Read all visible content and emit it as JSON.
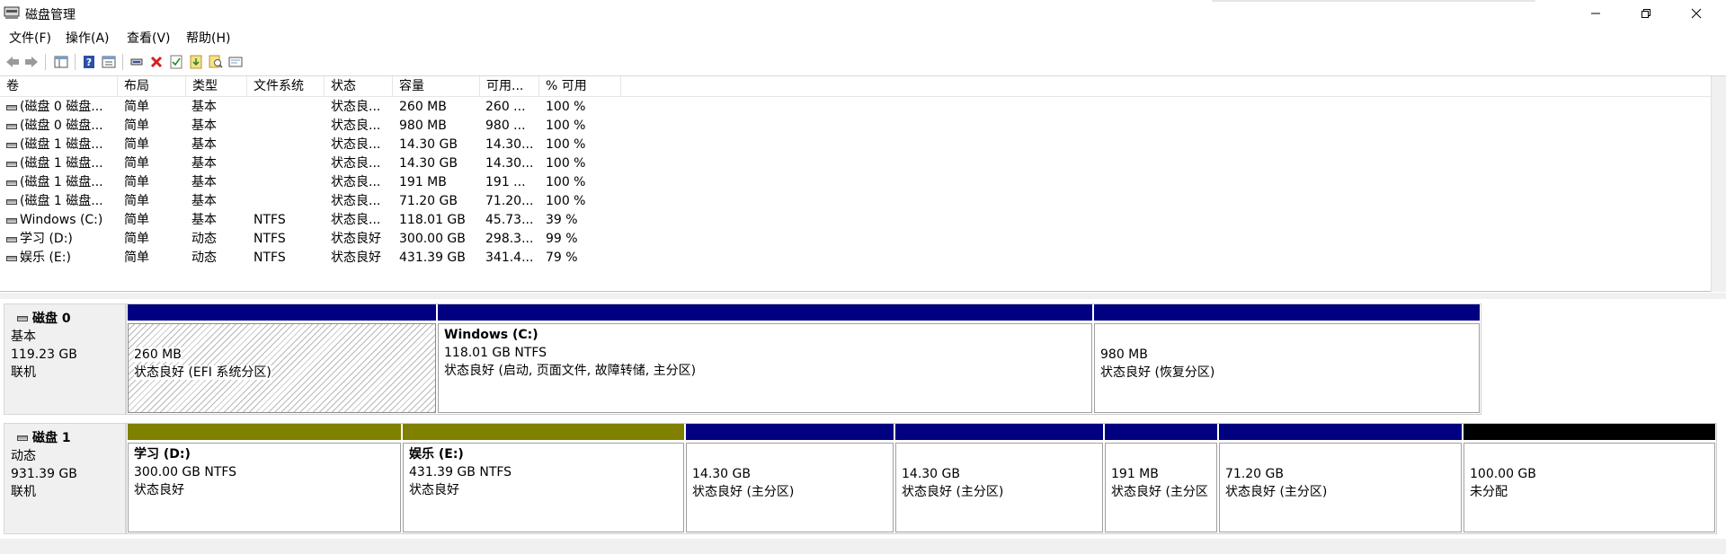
{
  "window": {
    "title": "磁盘管理"
  },
  "menu": [
    "文件(F)",
    "操作(A)",
    "查看(V)",
    "帮助(H)"
  ],
  "toolbar": {
    "icons": [
      "back-icon",
      "forward-icon",
      "console-tree-icon",
      "help-icon",
      "properties-icon",
      "connect-icon",
      "delete-icon",
      "check-icon",
      "import-icon",
      "search-icon",
      "settings-icon"
    ]
  },
  "colors": {
    "primary": "#000080",
    "simple_dynamic": "#808000",
    "unallocated": "#000000"
  },
  "columns": [
    "卷",
    "布局",
    "类型",
    "文件系统",
    "状态",
    "容量",
    "可用...",
    "% 可用"
  ],
  "volumes": [
    {
      "name": "(磁盘 0 磁盘...",
      "layout": "简单",
      "type": "基本",
      "fs": "",
      "status": "状态良...",
      "capacity": "260 MB",
      "free": "260 ...",
      "pct": "100 %"
    },
    {
      "name": "(磁盘 0 磁盘...",
      "layout": "简单",
      "type": "基本",
      "fs": "",
      "status": "状态良...",
      "capacity": "980 MB",
      "free": "980 ...",
      "pct": "100 %"
    },
    {
      "name": "(磁盘 1 磁盘...",
      "layout": "简单",
      "type": "基本",
      "fs": "",
      "status": "状态良...",
      "capacity": "14.30 GB",
      "free": "14.30...",
      "pct": "100 %"
    },
    {
      "name": "(磁盘 1 磁盘...",
      "layout": "简单",
      "type": "基本",
      "fs": "",
      "status": "状态良...",
      "capacity": "14.30 GB",
      "free": "14.30...",
      "pct": "100 %"
    },
    {
      "name": "(磁盘 1 磁盘...",
      "layout": "简单",
      "type": "基本",
      "fs": "",
      "status": "状态良...",
      "capacity": "191 MB",
      "free": "191 ...",
      "pct": "100 %"
    },
    {
      "name": "(磁盘 1 磁盘...",
      "layout": "简单",
      "type": "基本",
      "fs": "",
      "status": "状态良...",
      "capacity": "71.20 GB",
      "free": "71.20...",
      "pct": "100 %"
    },
    {
      "name": "Windows (C:)",
      "layout": "简单",
      "type": "基本",
      "fs": "NTFS",
      "status": "状态良...",
      "capacity": "118.01 GB",
      "free": "45.73...",
      "pct": "39 %"
    },
    {
      "name": "学习 (D:)",
      "layout": "简单",
      "type": "动态",
      "fs": "NTFS",
      "status": "状态良好",
      "capacity": "300.00 GB",
      "free": "298.3...",
      "pct": "99 %"
    },
    {
      "name": "娱乐 (E:)",
      "layout": "简单",
      "type": "动态",
      "fs": "NTFS",
      "status": "状态良好",
      "capacity": "431.39 GB",
      "free": "341.4...",
      "pct": "79 %"
    }
  ],
  "disks": [
    {
      "name": "磁盘 0",
      "type": "基本",
      "size": "119.23 GB",
      "state": "联机",
      "partitions": [
        {
          "label": "",
          "size": "260 MB",
          "status": "状态良好 (EFI 系统分区)",
          "bar": "primary"
        },
        {
          "label": "Windows  (C:)",
          "size": "118.01 GB NTFS",
          "status": "状态良好 (启动, 页面文件, 故障转储, 主分区)",
          "bar": "primary"
        },
        {
          "label": "",
          "size": "980 MB",
          "status": "状态良好 (恢复分区)",
          "bar": "primary"
        }
      ]
    },
    {
      "name": "磁盘 1",
      "type": "动态",
      "size": "931.39 GB",
      "state": "联机",
      "partitions": [
        {
          "label": "学习  (D:)",
          "size": "300.00 GB NTFS",
          "status": "状态良好",
          "bar": "simple_dynamic"
        },
        {
          "label": "娱乐  (E:)",
          "size": "431.39 GB NTFS",
          "status": "状态良好",
          "bar": "simple_dynamic"
        },
        {
          "label": "",
          "size": "14.30 GB",
          "status": "状态良好 (主分区)",
          "bar": "primary"
        },
        {
          "label": "",
          "size": "14.30 GB",
          "status": "状态良好 (主分区)",
          "bar": "primary"
        },
        {
          "label": "",
          "size": "191 MB",
          "status": "状态良好 (主分区",
          "bar": "primary"
        },
        {
          "label": "",
          "size": "71.20 GB",
          "status": "状态良好 (主分区)",
          "bar": "primary"
        },
        {
          "label": "",
          "size": "100.00 GB",
          "status": "未分配",
          "bar": "unallocated"
        }
      ]
    }
  ]
}
